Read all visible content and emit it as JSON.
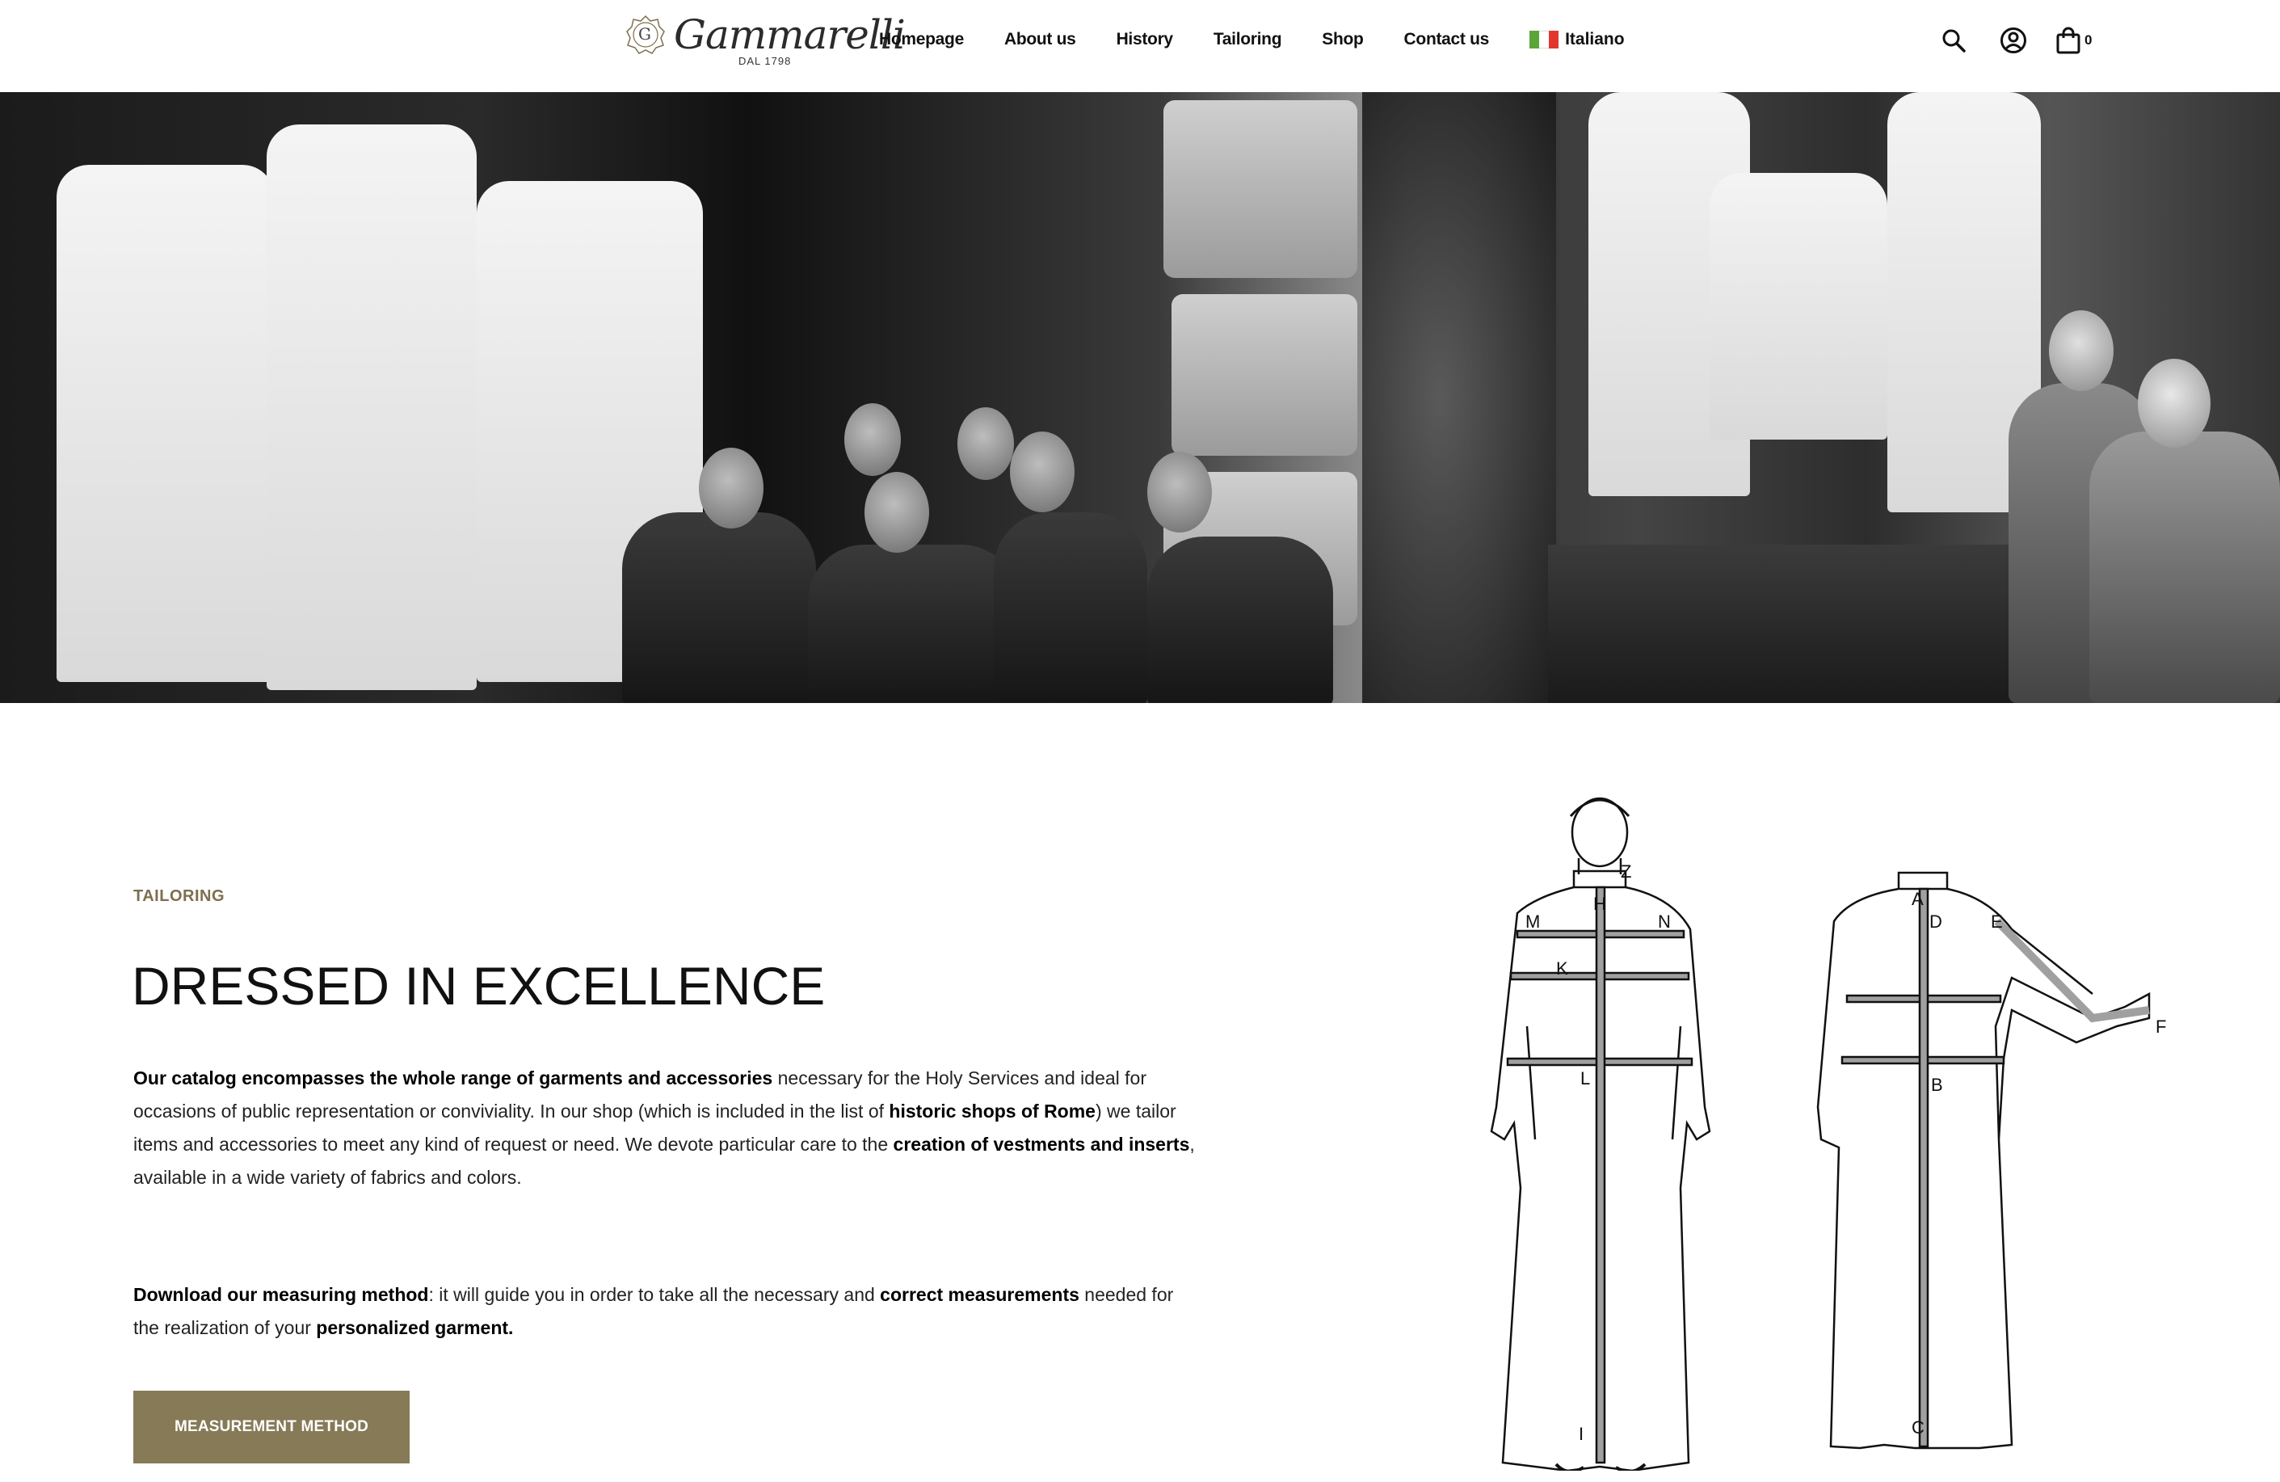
{
  "header": {
    "logo_initial": "G",
    "logo_name": "Gammarelli",
    "logo_since": "DAL 1798",
    "nav": [
      "Homepage",
      "About us",
      "History",
      "Tailoring",
      "Shop",
      "Contact us"
    ],
    "language": "Italiano",
    "cart_count": "0",
    "icons": [
      "search-icon",
      "user-icon",
      "shopping-bag-icon"
    ]
  },
  "content": {
    "kicker": "TAILORING",
    "title": "DRESSED IN EXCELLENCE",
    "p1": {
      "b1": "Our catalog encompasses the whole range of garments and accessories",
      "t1": " necessary for the Holy Services and ideal for occasions of public representation or conviviality. In our shop (which is included in the list of ",
      "b2": "historic shops of Rome",
      "t2": ") we tailor items and accessories to meet any kind of request or need. We devote particular care to the ",
      "b3": "creation of vestments and inserts",
      "t3": ", available in a wide variety of fabrics and colors."
    },
    "p2": {
      "b1": "Download our measuring method",
      "t1": ": it will guide you in order to take all the necessary and ",
      "b2": "correct measurements",
      "t2": " needed for the realization of your ",
      "b3": "personalized garment."
    },
    "button": "MEASUREMENT METHOD"
  },
  "diagram": {
    "front_labels": [
      "Z",
      "H",
      "M",
      "N",
      "K",
      "L",
      "I"
    ],
    "back_labels": [
      "A",
      "D",
      "E",
      "F",
      "B",
      "C"
    ]
  },
  "colors": {
    "accent": "#867a57",
    "kicker": "#7d6f4f",
    "flag": [
      "#5aa538",
      "#ffffff",
      "#e2372e"
    ]
  }
}
